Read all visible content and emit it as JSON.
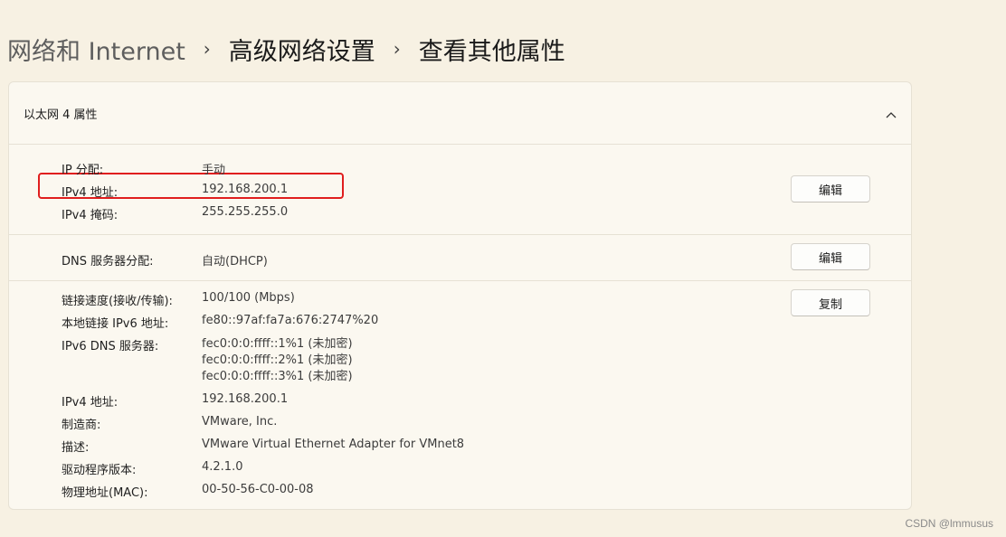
{
  "breadcrumb": {
    "root": "网络和 Internet",
    "middle": "高级网络设置",
    "current": "查看其他属性",
    "separator": "›"
  },
  "card": {
    "title": "以太网 4 属性",
    "toggle_icon": "chevron-up-icon"
  },
  "ip_section": {
    "assignment_label": "IP 分配:",
    "assignment_value": "手动",
    "ipv4_label": "IPv4 地址:",
    "ipv4_value": "192.168.200.1",
    "mask_label": "IPv4 掩码:",
    "mask_value": "255.255.255.0",
    "edit_label": "编辑"
  },
  "dns_section": {
    "label": "DNS 服务器分配:",
    "value": "自动(DHCP)",
    "edit_label": "编辑"
  },
  "details": {
    "copy_label": "复制",
    "rows": [
      {
        "label": "链接速度(接收/传输):",
        "value": "100/100 (Mbps)"
      },
      {
        "label": "本地链接 IPv6 地址:",
        "value": "fe80::97af:fa7a:676:2747%20"
      },
      {
        "label": "IPv6 DNS 服务器:",
        "values": [
          "fec0:0:0:ffff::1%1 (未加密)",
          "fec0:0:0:ffff::2%1 (未加密)",
          "fec0:0:0:ffff::3%1 (未加密)"
        ]
      },
      {
        "label": "IPv4 地址:",
        "value": "192.168.200.1"
      },
      {
        "label": "制造商:",
        "value": "VMware, Inc."
      },
      {
        "label": "描述:",
        "value": "VMware Virtual Ethernet Adapter for VMnet8"
      },
      {
        "label": "驱动程序版本:",
        "value": "4.2.1.0"
      },
      {
        "label": "物理地址(MAC):",
        "value": "00-50-56-C0-00-08"
      }
    ]
  },
  "annotation": {
    "color": "#e01e1e"
  },
  "watermark": "CSDN @lmmusus"
}
